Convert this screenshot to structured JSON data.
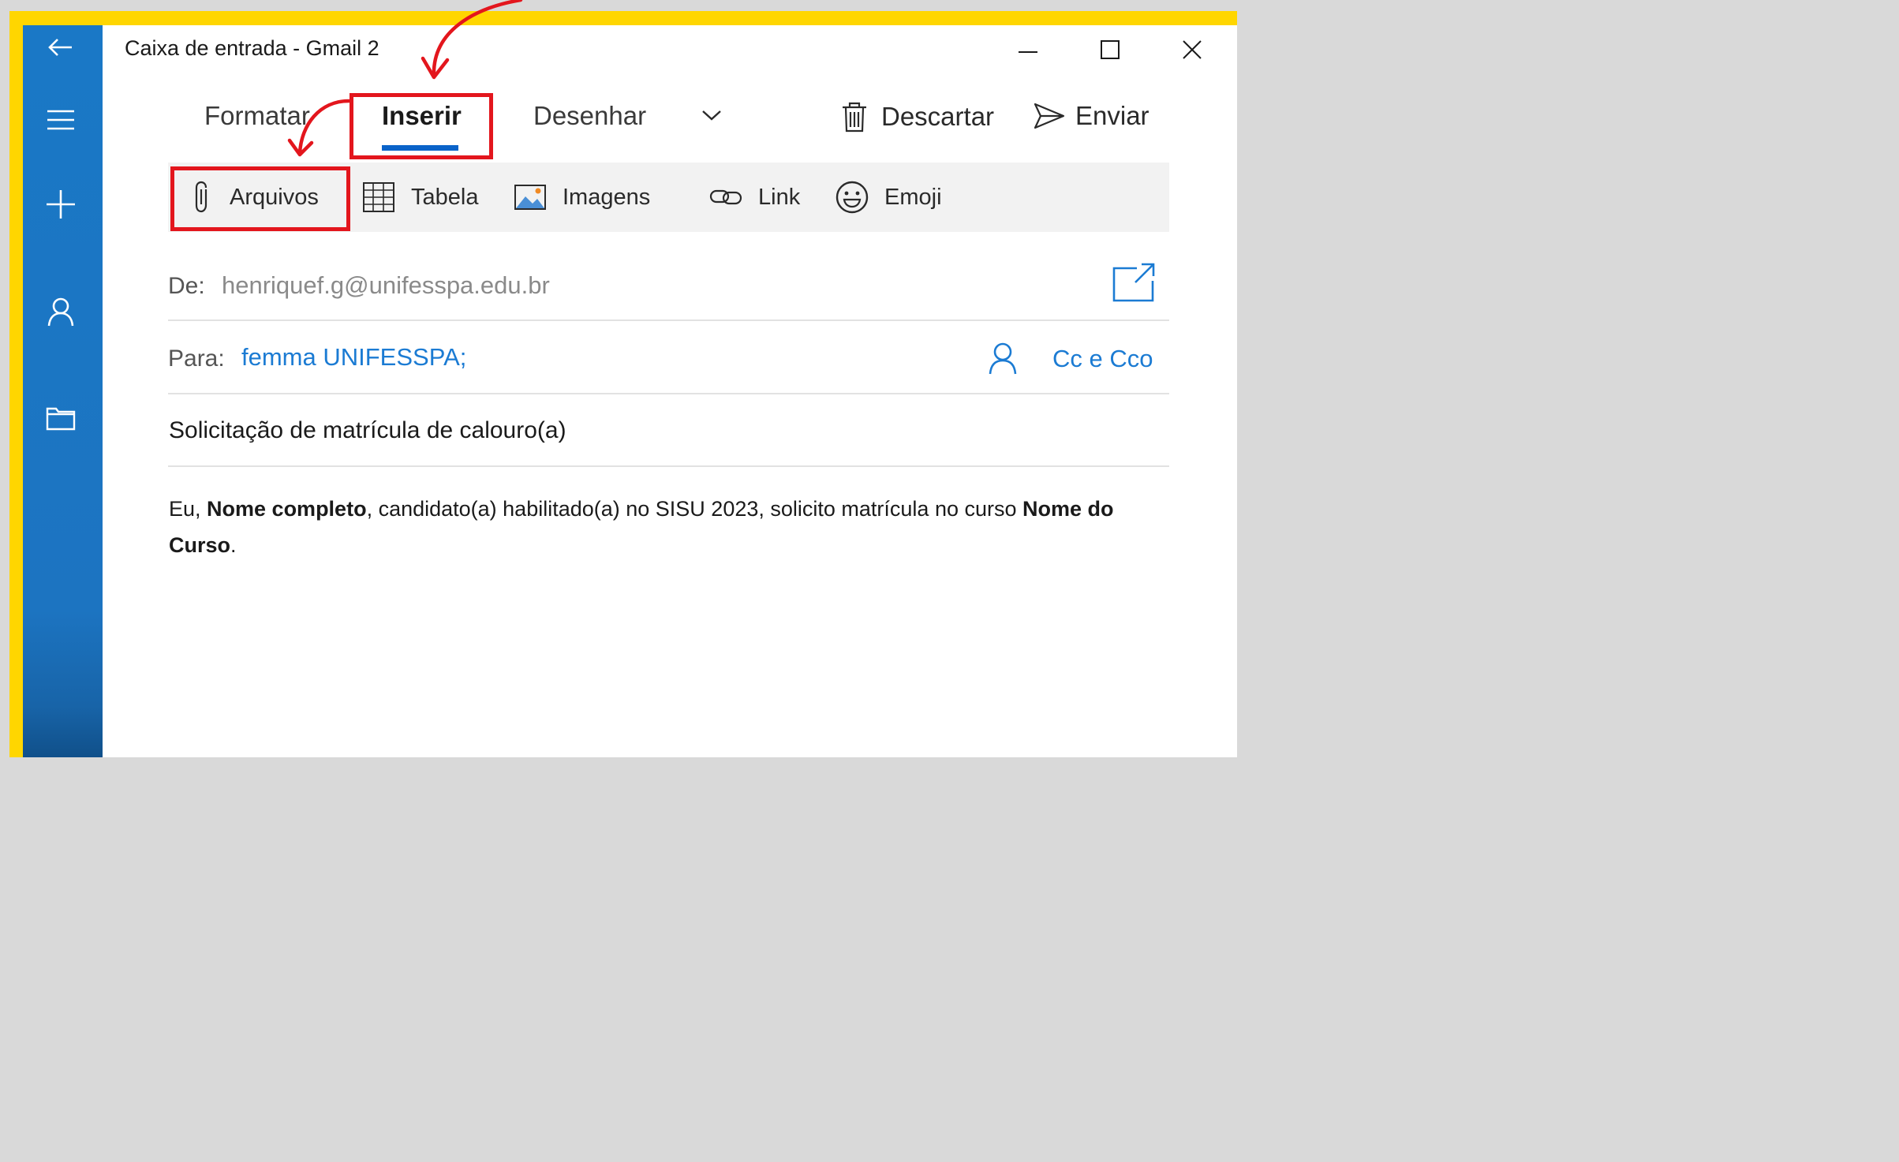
{
  "window": {
    "title": "Caixa de entrada - Gmail 2"
  },
  "tabs": [
    {
      "label": "Formatar"
    },
    {
      "label": "Inserir",
      "active": true
    },
    {
      "label": "Desenhar"
    }
  ],
  "commands": {
    "discard_label": "Descartar",
    "send_label": "Enviar"
  },
  "ribbon": {
    "items": [
      {
        "label": "Arquivos",
        "icon": "paperclip-icon"
      },
      {
        "label": "Tabela",
        "icon": "table-icon"
      },
      {
        "label": "Imagens",
        "icon": "image-icon"
      },
      {
        "label": "Link",
        "icon": "link-icon"
      },
      {
        "label": "Emoji",
        "icon": "emoji-icon"
      }
    ]
  },
  "compose": {
    "from_label": "De:",
    "from_value": "henriquef.g@unifesspa.edu.br",
    "to_label": "Para:",
    "to_value": "femma UNIFESSPA;",
    "cc_bcc_label": "Cc e Cco",
    "subject": "Solicitação de matrícula de calouro(a)",
    "body": {
      "p1": "Eu, ",
      "p2_bold": "Nome completo",
      "p3": ", candidato(a) habilitado(a) no SISU 2023, solicito matrícula no curso ",
      "p4_bold": "Nome do Curso",
      "p5": "."
    }
  },
  "colors": {
    "frame": "#ffd600",
    "sidebar": "#1a78c6",
    "accent": "#0a63c9",
    "link_blue": "#1b7bd3",
    "highlight": "#e3161d"
  }
}
